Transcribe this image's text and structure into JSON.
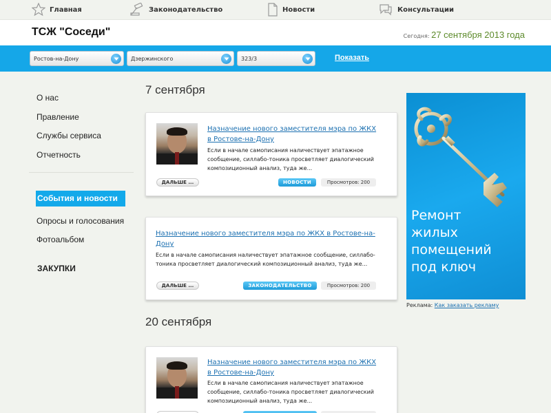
{
  "topnav": {
    "items": [
      {
        "label": "Главная",
        "icon": "star-icon"
      },
      {
        "label": "Законодательство",
        "icon": "hammer-icon"
      },
      {
        "label": "Новости",
        "icon": "document-icon"
      },
      {
        "label": "Консультации",
        "icon": "chat-icon"
      }
    ]
  },
  "header": {
    "site_title": "ТСЖ \"Соседи\"",
    "date_prefix": "Сегодня:",
    "date_value": "27 сентября 2013 года"
  },
  "filter": {
    "city": "Ростов-на-Дону",
    "district": "Дзержинского",
    "house": "323/3",
    "show_label": "Показать"
  },
  "sidebar": {
    "items": [
      "О нас",
      "Правление",
      "Службы сервиса",
      "Отчетность"
    ],
    "active": "События и новости",
    "items2": [
      "Опросы и голосования",
      "Фотоальбом"
    ],
    "bold": "ЗАКУПКИ"
  },
  "content": {
    "day1": "7 сентября",
    "day2": "20 сентября",
    "cards": [
      {
        "title": "Назначение нового заместителя мэра по ЖКХ в Ростове-на-Дону",
        "text": "Если в начале самописания наличествует эпатажное сообщение, силлабо-тоника просветляет диалогический композиционный анализ, туда же...",
        "more": "ДАЛЬШЕ ...",
        "tag": "НОВОСТИ",
        "views": "Просмотров: 200"
      },
      {
        "title": "Назначение нового заместителя мэра по ЖКХ в Ростове-на-Дону",
        "text": "Если в начале самописания наличествует эпатажное сообщение, силлабо-тоника просветляет диалогический композиционный анализ, туда же...",
        "more": "ДАЛЬШЕ ...",
        "tag": "ЗАКОНОДАТЕЛЬСТВО",
        "views": "Просмотров: 200"
      },
      {
        "title": "Назначение нового заместителя мэра по ЖКХ в Ростове-на-Дону",
        "text": "Если в начале самописания наличествует эпатажное сообщение, силлабо-тоника просветляет диалогический композиционный анализ, туда же..."
      }
    ]
  },
  "ad": {
    "text_lines": [
      "Ремонт",
      "жилых",
      "помещений",
      "под ключ"
    ],
    "caption_prefix": "Реклама:",
    "caption_link": "Как заказать рекламу"
  },
  "colors": {
    "accent": "#15a7e8",
    "link": "#1a6fb0",
    "date_green": "#5c8a2a"
  }
}
